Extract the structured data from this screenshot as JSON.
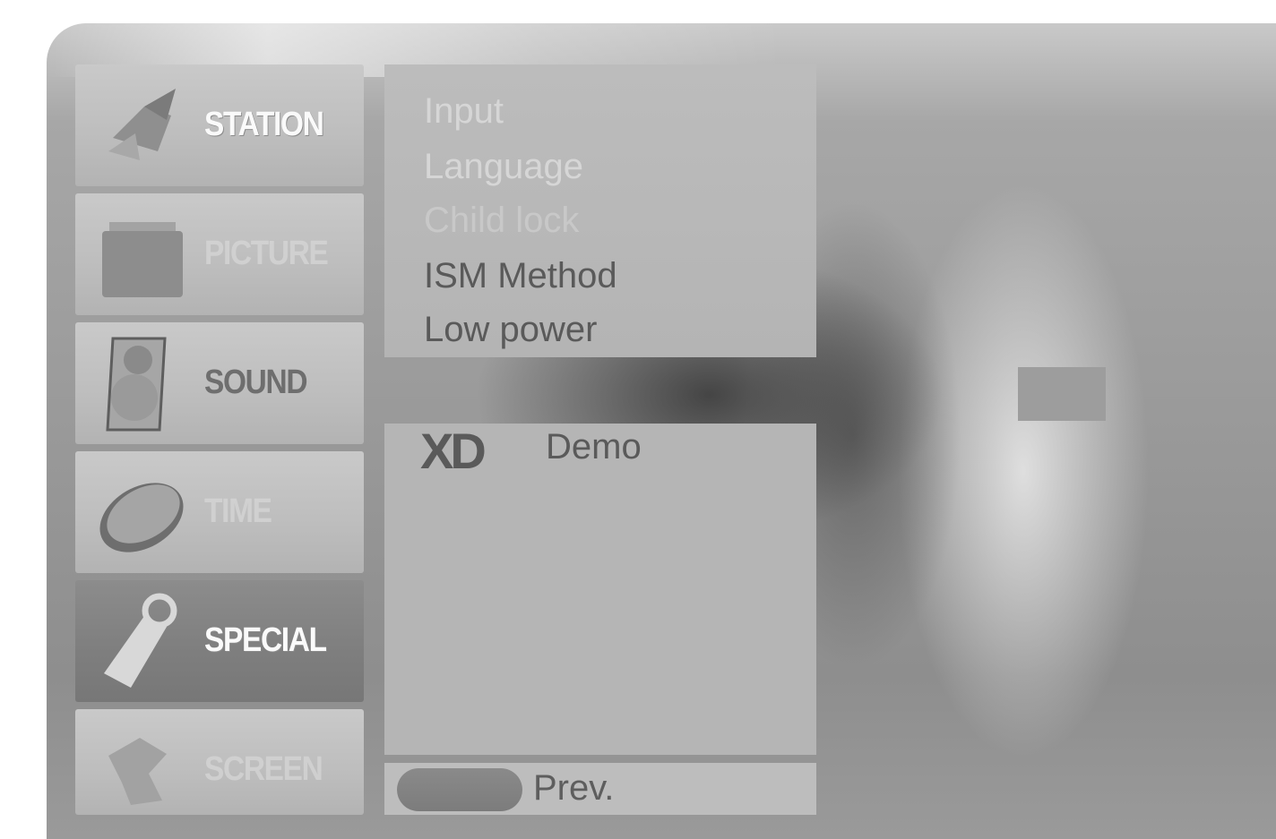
{
  "sidebar": {
    "items": [
      {
        "label": "STATION",
        "icon": "satellite-icon"
      },
      {
        "label": "PICTURE",
        "icon": "picture-icon"
      },
      {
        "label": "SOUND",
        "icon": "speaker-icon"
      },
      {
        "label": "TIME",
        "icon": "clock-icon"
      },
      {
        "label": "SPECIAL",
        "icon": "tag-icon",
        "selected": true
      },
      {
        "label": "SCREEN",
        "icon": "screen-icon"
      }
    ]
  },
  "submenu": {
    "options": [
      "Input",
      "Language",
      "Child lock",
      "ISM Method",
      "Low power"
    ]
  },
  "panel": {
    "logo": "XD",
    "demo_label": "Demo"
  },
  "footer": {
    "prev_label": "Prev."
  }
}
